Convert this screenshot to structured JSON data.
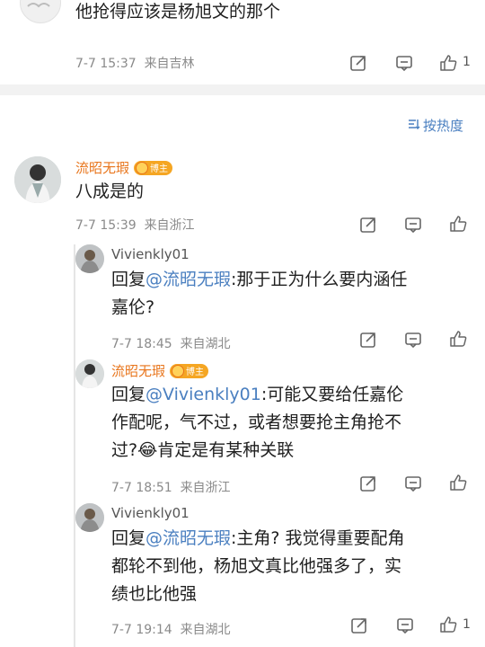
{
  "top_comment": {
    "text": "他抢得应该是杨旭文的那个",
    "time_location": "7-7 15:37  来自吉林",
    "like_count": "1"
  },
  "sort": {
    "label": "按热度"
  },
  "main_comment": {
    "author": "流昭无瑕",
    "badge": "博主",
    "text": "八成是的",
    "time_location": "7-7 15:39  来自浙江"
  },
  "replies": [
    {
      "author": "Vivienkly01",
      "reply_prefix": "回复",
      "mention": "@流昭无瑕",
      "line1_rest": ":那于正为什么要内涵任",
      "line2": "嘉伦?",
      "time_location": "7-7 18:45  来自湖北"
    },
    {
      "author": "流昭无瑕",
      "badge": "博主",
      "reply_prefix": "回复",
      "mention": "@Vivienkly01",
      "line1_rest": ":可能又要给任嘉伦",
      "line2": "作配呢，气不过，或者想要抢主角抢不",
      "line3_pre": "过?",
      "emoji": "😂",
      "line3_post": "肯定是有某种关联",
      "time_location": "7-7 18:51  来自浙江"
    },
    {
      "author": "Vivienkly01",
      "reply_prefix": "回复",
      "mention": "@流昭无瑕",
      "line1_rest": ":主角? 我觉得重要配角",
      "line2": "都轮不到他，杨旭文真比他强多了，实",
      "line3": "绩也比他强",
      "time_location": "7-7 19:14  来自湖北",
      "like_count": "1"
    }
  ]
}
